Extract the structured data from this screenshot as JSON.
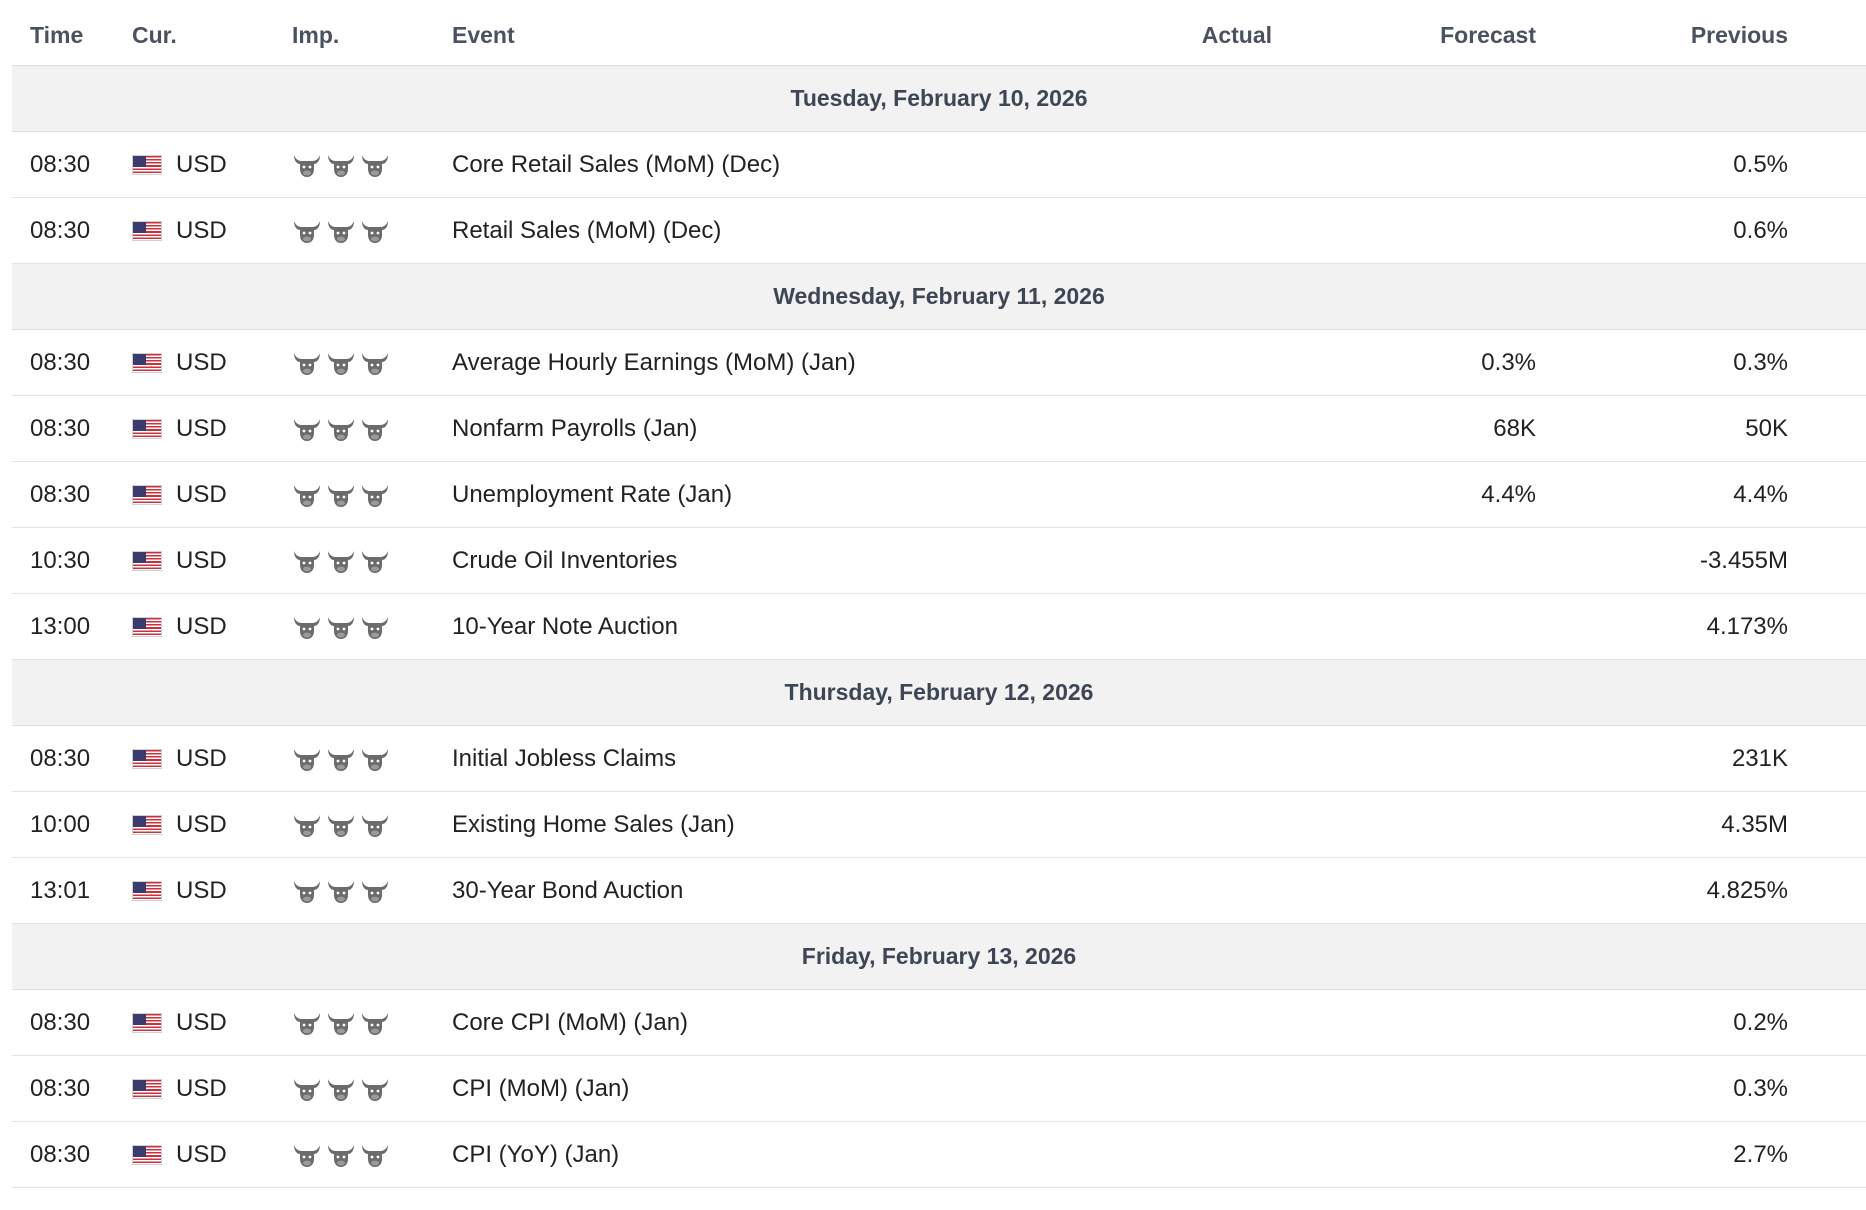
{
  "columns": {
    "time": "Time",
    "currency": "Cur.",
    "importance": "Imp.",
    "event": "Event",
    "actual": "Actual",
    "forecast": "Forecast",
    "previous": "Previous"
  },
  "colors": {
    "day_header_bg": "#f2f2f2",
    "importance_icon": "#6b6b6b",
    "row_border": "#e3e3e3"
  },
  "days": [
    {
      "label": "Tuesday, February 10, 2026",
      "events": [
        {
          "time": "08:30",
          "currency": "USD",
          "flag_icon": "us-flag-icon",
          "importance": 3,
          "event": "Core Retail Sales (MoM) (Dec)",
          "actual": "",
          "forecast": "",
          "previous": "0.5%"
        },
        {
          "time": "08:30",
          "currency": "USD",
          "flag_icon": "us-flag-icon",
          "importance": 3,
          "event": "Retail Sales (MoM) (Dec)",
          "actual": "",
          "forecast": "",
          "previous": "0.6%"
        }
      ]
    },
    {
      "label": "Wednesday, February 11, 2026",
      "events": [
        {
          "time": "08:30",
          "currency": "USD",
          "flag_icon": "us-flag-icon",
          "importance": 3,
          "event": "Average Hourly Earnings (MoM) (Jan)",
          "actual": "",
          "forecast": "0.3%",
          "previous": "0.3%"
        },
        {
          "time": "08:30",
          "currency": "USD",
          "flag_icon": "us-flag-icon",
          "importance": 3,
          "event": "Nonfarm Payrolls (Jan)",
          "actual": "",
          "forecast": "68K",
          "previous": "50K"
        },
        {
          "time": "08:30",
          "currency": "USD",
          "flag_icon": "us-flag-icon",
          "importance": 3,
          "event": "Unemployment Rate (Jan)",
          "actual": "",
          "forecast": "4.4%",
          "previous": "4.4%"
        },
        {
          "time": "10:30",
          "currency": "USD",
          "flag_icon": "us-flag-icon",
          "importance": 3,
          "event": "Crude Oil Inventories",
          "actual": "",
          "forecast": "",
          "previous": "-3.455M"
        },
        {
          "time": "13:00",
          "currency": "USD",
          "flag_icon": "us-flag-icon",
          "importance": 3,
          "event": "10-Year Note Auction",
          "actual": "",
          "forecast": "",
          "previous": "4.173%"
        }
      ]
    },
    {
      "label": "Thursday, February 12, 2026",
      "events": [
        {
          "time": "08:30",
          "currency": "USD",
          "flag_icon": "us-flag-icon",
          "importance": 3,
          "event": "Initial Jobless Claims",
          "actual": "",
          "forecast": "",
          "previous": "231K"
        },
        {
          "time": "10:00",
          "currency": "USD",
          "flag_icon": "us-flag-icon",
          "importance": 3,
          "event": "Existing Home Sales (Jan)",
          "actual": "",
          "forecast": "",
          "previous": "4.35M"
        },
        {
          "time": "13:01",
          "currency": "USD",
          "flag_icon": "us-flag-icon",
          "importance": 3,
          "event": "30-Year Bond Auction",
          "actual": "",
          "forecast": "",
          "previous": "4.825%"
        }
      ]
    },
    {
      "label": "Friday, February 13, 2026",
      "events": [
        {
          "time": "08:30",
          "currency": "USD",
          "flag_icon": "us-flag-icon",
          "importance": 3,
          "event": "Core CPI (MoM) (Jan)",
          "actual": "",
          "forecast": "",
          "previous": "0.2%"
        },
        {
          "time": "08:30",
          "currency": "USD",
          "flag_icon": "us-flag-icon",
          "importance": 3,
          "event": "CPI (MoM) (Jan)",
          "actual": "",
          "forecast": "",
          "previous": "0.3%"
        },
        {
          "time": "08:30",
          "currency": "USD",
          "flag_icon": "us-flag-icon",
          "importance": 3,
          "event": "CPI (YoY) (Jan)",
          "actual": "",
          "forecast": "",
          "previous": "2.7%"
        }
      ]
    }
  ]
}
